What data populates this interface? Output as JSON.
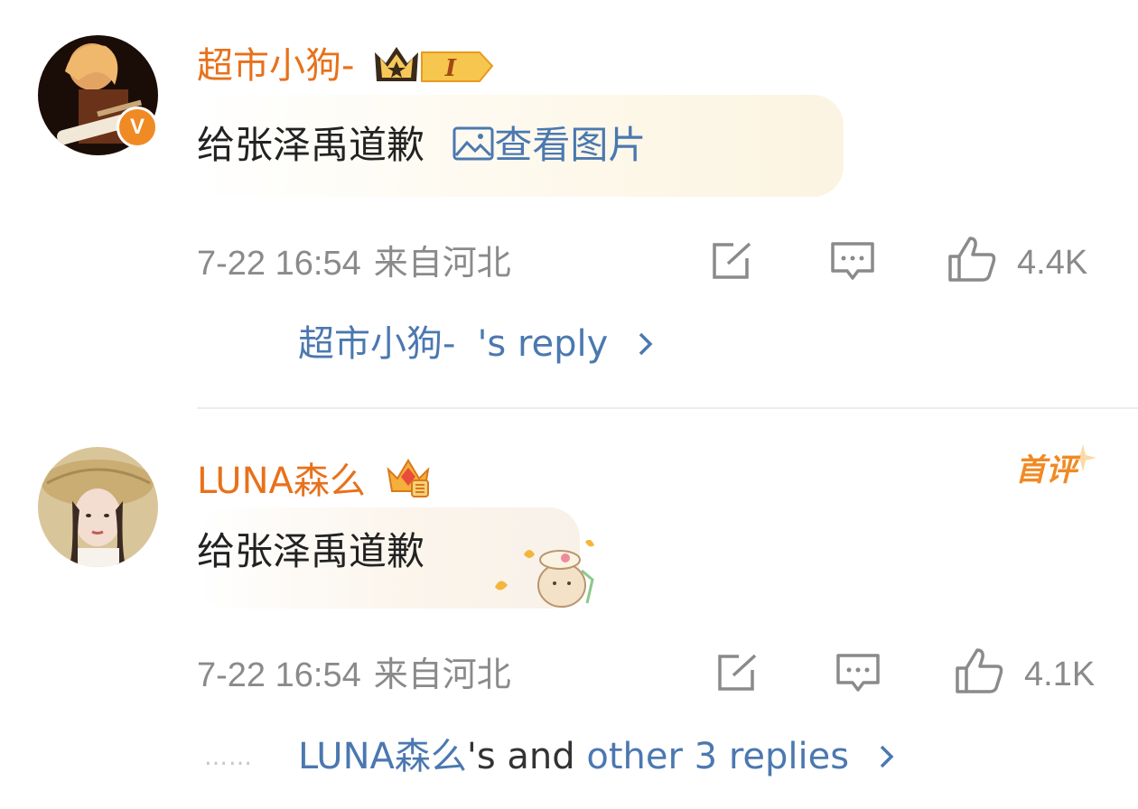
{
  "comments": [
    {
      "username": "超市小狗-",
      "level_badge": "I",
      "verified_badge": "V",
      "text": "给张泽禹道歉",
      "view_image_label": "查看图片",
      "time": "7-22 16:54",
      "location": "来自河北",
      "likes": "4.4K",
      "reply_user": "超市小狗-",
      "reply_suffix": "'s reply",
      "icons": [
        "share-icon",
        "comment-icon",
        "like-icon",
        "chevron-right-icon"
      ]
    },
    {
      "username": "LUNA森么",
      "first_badge": "首评",
      "text": "给张泽禹道歉",
      "time": "7-22 16:54",
      "location": "来自河北",
      "likes": "4.1K",
      "dots": "……",
      "reply_user": "LUNA森么",
      "reply_mid": "'s and ",
      "reply_suffix": "other 3 replies",
      "icons": [
        "share-icon",
        "comment-icon",
        "like-icon",
        "chevron-right-icon"
      ]
    }
  ],
  "colors": {
    "username": "#e8711b",
    "link": "#4b78b0",
    "meta": "#8a8a8a",
    "badge": "#f08a24"
  }
}
